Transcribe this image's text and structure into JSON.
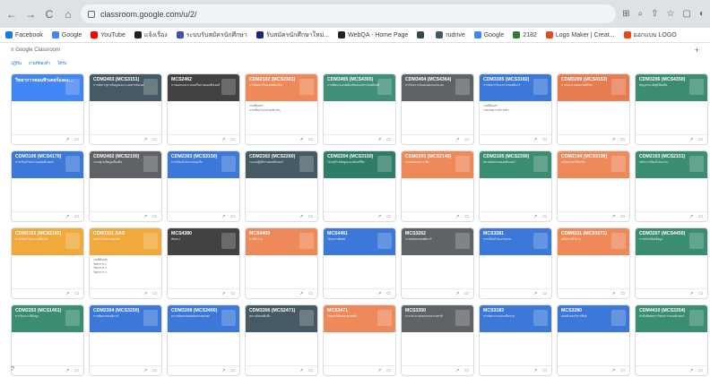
{
  "browser": {
    "url": "classroom.google.com/u/2/",
    "back": "←",
    "forward": "→",
    "reload": "C",
    "home": "⌂",
    "right_icons": [
      "⊞",
      "⌕",
      "⇧",
      "☆",
      "▢",
      "◐"
    ]
  },
  "bookmarks": [
    {
      "label": "Facebook",
      "color": "#1877f2"
    },
    {
      "label": "Google",
      "color": "#4285f4"
    },
    {
      "label": "YouTube",
      "color": "#ff0000"
    },
    {
      "label": "แจ้งเรื่อง",
      "color": "#202124"
    },
    {
      "label": "ระบบรับสมัครนักศึกษา",
      "color": "#3f51b5"
    },
    {
      "label": "รับสมัครนักศึกษาใหม่...",
      "color": "#1a237e"
    },
    {
      "label": "WebQA - Home Page",
      "color": "#202124"
    },
    {
      "label": "",
      "color": "#37474f"
    },
    {
      "label": "rudrive",
      "color": "#455a64"
    },
    {
      "label": "Google",
      "color": "#4285f4"
    },
    {
      "label": "2182",
      "color": "#2e7d32"
    },
    {
      "label": "Logo Maker | Creat...",
      "color": "#e64a19"
    },
    {
      "label": "ออกแบบ LOGO",
      "color": "#e64a19"
    }
  ],
  "app": {
    "title": "Google Classroom",
    "plus": "+",
    "menu": "≡",
    "help": "?"
  },
  "tabs": [
    "ปฏิทิน",
    "งานที่ต้องทำ",
    "ได้รับ"
  ],
  "cards": [
    {
      "title": "วิทยาการคอมพิวเตอร์และเทคนิค",
      "sub": "",
      "color": "#4285f4",
      "body": []
    },
    {
      "title": "CDM2403 (MCS3151)",
      "sub": "การจัดการฐานข้อมูลและระบบสารสนเทศ",
      "color": "#455a64",
      "body": []
    },
    {
      "title": "MCS2462",
      "sub": "การออกแบบระบบเครือข่ายคอมพิวเตอร์",
      "color": "#424242",
      "body": []
    },
    {
      "title": "CDM2102 (MCS2301)",
      "sub": "การพัฒนาเว็บแอปพลิเคชัน",
      "color": "#ee8a5a",
      "body": [
        "งานที่ต้องทำ",
        "การเขียนโปรแกรมเชิงวัตถุ"
      ]
    },
    {
      "title": "CDM3405 (MCS4365)",
      "sub": "การพัฒนาแอปพลิเคชันบนอุปกรณ์เคลื่อนที่",
      "color": "#3f8f7a",
      "body": []
    },
    {
      "title": "CDM3404 (MCS4364)",
      "sub": "การวิเคราะห์และออกแบบระบบ",
      "color": "#5f6368",
      "body": []
    },
    {
      "title": "CDM3305 (MCS3182)",
      "sub": "การจัดการโครงการซอฟต์แวร์",
      "color": "#3c78d8",
      "body": [
        "งานที่ต้องทำ",
        "รายงานความก้าวหน้า"
      ]
    },
    {
      "title": "CDM3209 (MCS4153)",
      "sub": "การประมวลผลภาพดิจิทัล",
      "color": "#e67c50",
      "body": []
    },
    {
      "title": "CDM3206 (MCS4350)",
      "sub": "ปัญญาประดิษฐ์เบื้องต้น",
      "color": "#3a8c72",
      "body": []
    },
    {
      "title": "CDM3106 (MCS4170)",
      "sub": "การเขียนโปรแกรมคอมพิวเตอร์",
      "color": "#3c78d8",
      "body": []
    },
    {
      "title": "CDM2402 (MCS2150)",
      "sub": "ระบบฐานข้อมูลเบื้องต้น",
      "color": "#5f6368",
      "body": []
    },
    {
      "title": "CDM2303 (MCS3150)",
      "sub": "การเขียนโปรแกรมบนเว็บ",
      "color": "#3c78d8",
      "body": []
    },
    {
      "title": "CDM2302 (MCS2260)",
      "sub": "ระบบปฏิบัติการคอมพิวเตอร์",
      "color": "#455a64",
      "body": []
    },
    {
      "title": "CDM2204 (MCS3150)",
      "sub": "โครงสร้างข้อมูลและอัลกอริทึม",
      "color": "#2f7d68",
      "body": []
    },
    {
      "title": "CDM2201 (MCS2140)",
      "sub": "การออกแบบกราฟิก",
      "color": "#ee8a5a",
      "body": []
    },
    {
      "title": "CDM2105 (MCS2390)",
      "sub": "สถาปัตยกรรมคอมพิวเตอร์",
      "color": "#3a8c72",
      "body": []
    },
    {
      "title": "CDM2104 (MCS3190)",
      "sub": "คณิตศาสตร์ดิสครีต",
      "color": "#ee8a5a",
      "body": []
    },
    {
      "title": "CDM2103 (MCS2151)",
      "sub": "หลักการเขียนโปรแกรม",
      "color": "#3a8c72",
      "body": []
    },
    {
      "title": "CDM2102 (MCS2162)",
      "sub": "การเขียนโปรแกรมเบื้องต้น",
      "color": "#f0a93b",
      "body": []
    },
    {
      "title": "CDM1101 SAS",
      "sub": "เทคโนโลยีสารสนเทศ",
      "color": "#f0a93b",
      "body": [
        "งานที่ต้องทำ",
        "วิทยาการ 1",
        "วิทยาการ 2",
        "วิทยาการ 3"
      ]
    },
    {
      "title": "MCS4380",
      "sub": "สัมมนา",
      "color": "#424242",
      "body": []
    },
    {
      "title": "MCS4409",
      "sub": "การฝึกงาน",
      "color": "#ee8a5a",
      "body": []
    },
    {
      "title": "MCS4461",
      "sub": "โครงงานพิเศษ",
      "color": "#3c78d8",
      "body": []
    },
    {
      "title": "MCS3262",
      "sub": "การทดสอบซอฟต์แวร์",
      "color": "#5f6368",
      "body": []
    },
    {
      "title": "MCS3281",
      "sub": "การเขียนโปรแกรมเกม",
      "color": "#3c78d8",
      "body": []
    },
    {
      "title": "CDM4311 (MCS3271)",
      "sub": "เครือข่ายไร้สาย",
      "color": "#ee8a5a",
      "body": []
    },
    {
      "title": "CDM3207 (MCS4450)",
      "sub": "การทำเหมืองข้อมูล",
      "color": "#3a8c72",
      "body": []
    },
    {
      "title": "CDM2203 (MCS1461)",
      "sub": "การวิเคราะห์ข้อมูล",
      "color": "#3a8c72",
      "body": []
    },
    {
      "title": "CDM2304 (MCS3250)",
      "sub": "การพัฒนาซอฟต์แวร์",
      "color": "#3c78d8",
      "body": []
    },
    {
      "title": "CDM3308 (MCS3400)",
      "sub": "ความมั่นคงปลอดภัยสารสนเทศ",
      "color": "#3c78d8",
      "body": []
    },
    {
      "title": "CDM3306 (MCS2471)",
      "sub": "คลาวด์คอมพิวติ้ง",
      "color": "#455a64",
      "body": []
    },
    {
      "title": "MCS3471",
      "sub": "อินเทอร์เน็ตของสรรพสิ่ง",
      "color": "#ee8a5a",
      "body": []
    },
    {
      "title": "MCS3350",
      "sub": "การประมวลผลภาษาธรรมชาติ",
      "color": "#5f6368",
      "body": []
    },
    {
      "title": "MCS3183",
      "sub": "การจัดการระบบเครือข่าย",
      "color": "#3c78d8",
      "body": []
    },
    {
      "title": "MCS3280",
      "sub": "คอมพิวเตอร์กราฟิกส์",
      "color": "#3c78d8",
      "body": []
    },
    {
      "title": "CDM4410 (MCS3354)",
      "sub": "หัวข้อพิเศษทางวิทยาการคอมพิวเตอร์",
      "color": "#3a8c72",
      "body": []
    }
  ],
  "card_icons": {
    "trend": "↗",
    "folder": "▭"
  }
}
